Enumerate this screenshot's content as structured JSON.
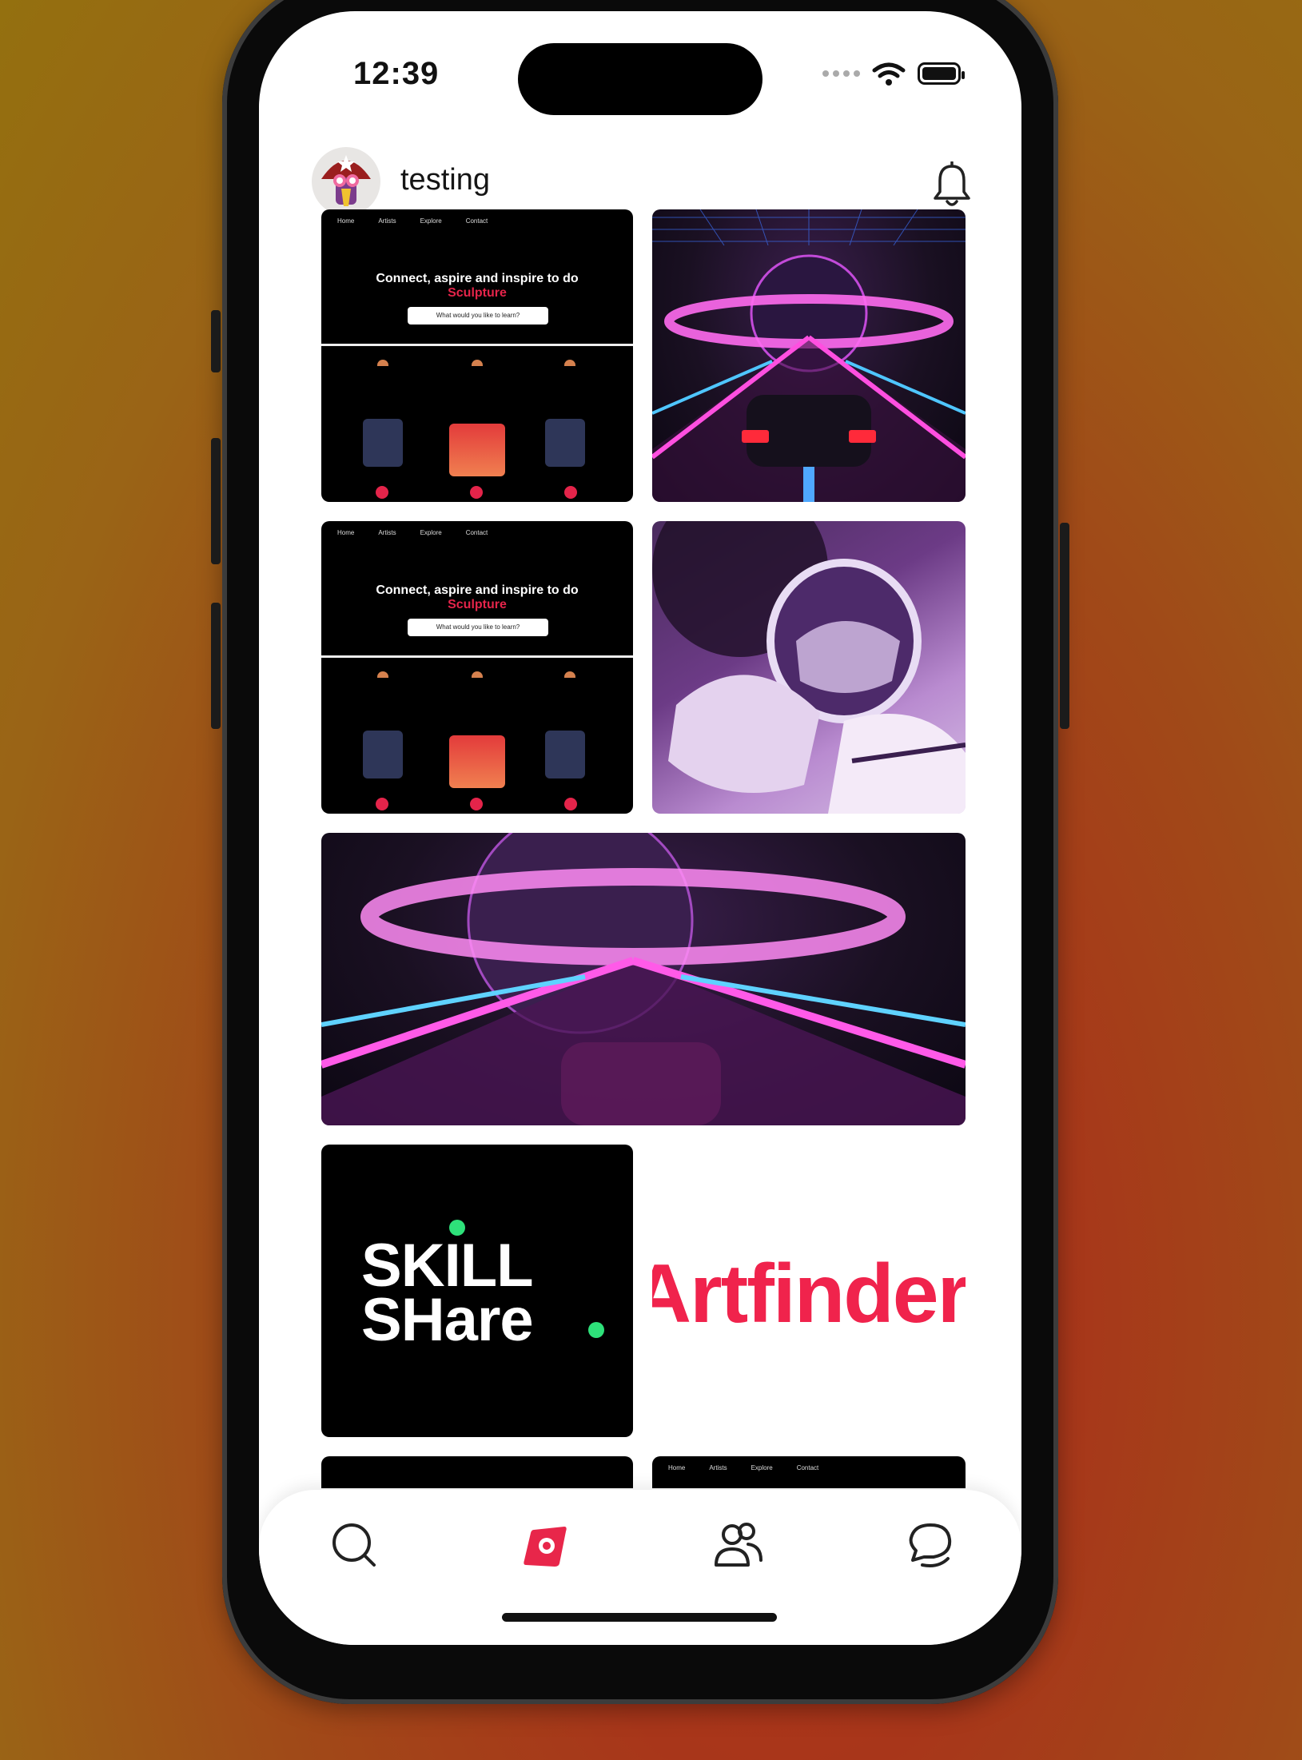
{
  "status_bar": {
    "time": "12:39"
  },
  "header": {
    "username": "testing",
    "avatar_icon": "wizard-avatar-icon",
    "notification_icon": "bell-icon"
  },
  "feed": {
    "web_preview": {
      "nav": [
        "Home",
        "Artists",
        "Explore",
        "Contact"
      ],
      "headline": "Connect, aspire and inspire to do",
      "accent": "Sculpture",
      "search_placeholder": "What would you like to learn?"
    },
    "skillshare": {
      "line1": "SKILL",
      "line2": "SHare"
    },
    "artfinder": {
      "wordmark": "Artfinder"
    }
  },
  "tab_bar": {
    "items": [
      {
        "id": "search",
        "icon": "search-icon",
        "active": false
      },
      {
        "id": "feed",
        "icon": "feed-icon",
        "active": true
      },
      {
        "id": "community",
        "icon": "people-icon",
        "active": false
      },
      {
        "id": "chat",
        "icon": "chat-icon",
        "active": false
      }
    ],
    "active_color": "#e8264a"
  }
}
